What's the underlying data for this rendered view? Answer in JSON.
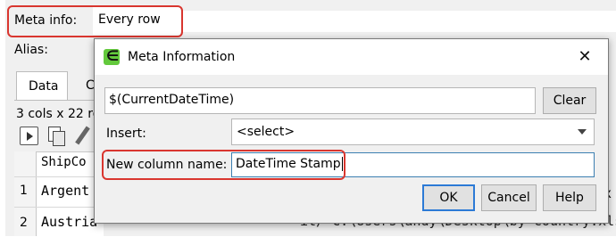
{
  "background": {
    "meta_info_label": "Meta info:",
    "meta_info_value": "Every row",
    "alias_label": "Alias:",
    "tabs": [
      {
        "label": "Data"
      },
      {
        "label": "C"
      }
    ],
    "rows_summary": "3 cols x 22 ro",
    "grid_header": "ShipCo",
    "rows": [
      {
        "num": "1",
        "value": "Argent"
      },
      {
        "num": "2",
        "value": "Austria"
      }
    ],
    "path_fragment": "it/ C:\\Users\\andy\\Desktop\\by country.xlsx",
    "right_fragment": "x"
  },
  "dialog": {
    "title": "Meta Information",
    "app_icon": "easydatatransform-icon",
    "formula_value": "$(CurrentDateTime)",
    "clear_label": "Clear",
    "insert_label": "Insert:",
    "insert_value": "<select>",
    "column_name_label": "New column name:",
    "column_name_value": "DateTime Stamp",
    "ok_label": "OK",
    "cancel_label": "Cancel",
    "help_label": "Help"
  },
  "colors": {
    "highlight": "#d9362f",
    "focus": "#3c7fb1",
    "default_button_border": "#2c7ad6",
    "app_icon": "#63c93c"
  }
}
